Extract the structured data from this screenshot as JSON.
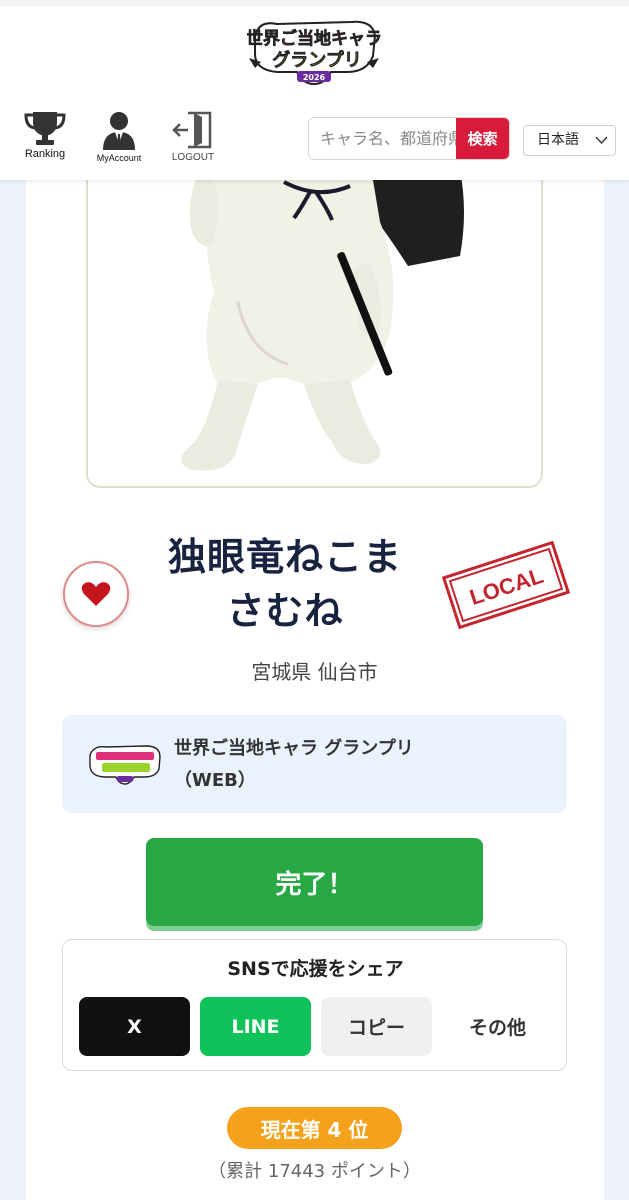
{
  "header": {
    "logo": {
      "line1": "世界ご当地キャラ",
      "line2": "グランプリ",
      "year": "2026"
    },
    "nav": [
      {
        "label": "Ranking",
        "icon": "trophy-icon"
      },
      {
        "label": "MyAccount",
        "icon": "user-icon"
      },
      {
        "label": "LOGOUT",
        "icon": "logout-icon"
      }
    ],
    "search": {
      "placeholder": "キャラ名、都道府県",
      "button": "検索"
    },
    "language": "日本語"
  },
  "character": {
    "name_line1": "独眼竜ねこま",
    "name_line2": "さむね",
    "stamp": "LOCAL",
    "location": "宮城県 仙台市",
    "favorite_icon": "heart-icon"
  },
  "event": {
    "line1": "世界ご当地キャラ グランプリ",
    "line2": "（WEB）"
  },
  "done_label": "完了！",
  "share": {
    "title": "SNSで応援をシェア",
    "buttons": [
      "X",
      "LINE",
      "コピー",
      "その他"
    ]
  },
  "rank": {
    "badge": "現在第 4 位",
    "points": "（累計 17443 ポイント）"
  },
  "colors": {
    "brand_red": "#d81b3b",
    "done_green": "#27a845",
    "line_green": "#10c25a",
    "rank_orange": "#f4a11c",
    "title_navy": "#18233f"
  }
}
